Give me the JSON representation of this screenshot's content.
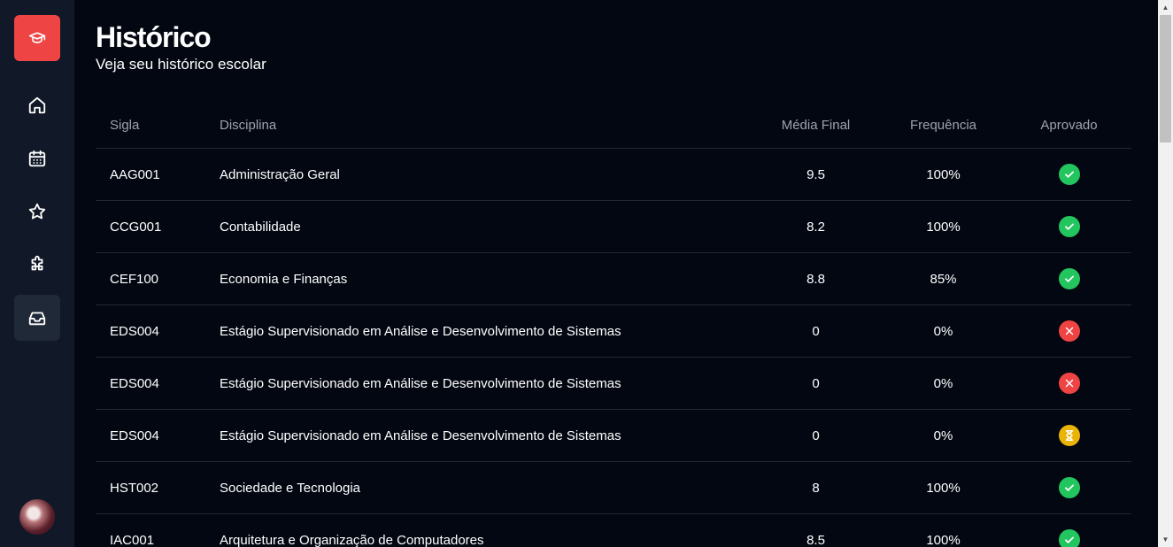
{
  "sidebar": {
    "logo_icon": "graduation-cap-icon",
    "brand_color": "#ef4444",
    "items": [
      {
        "name": "home",
        "icon": "home-icon"
      },
      {
        "name": "calendar",
        "icon": "calendar-icon"
      },
      {
        "name": "favorites",
        "icon": "star-icon"
      },
      {
        "name": "extensions",
        "icon": "puzzle-icon"
      },
      {
        "name": "history",
        "icon": "inbox-icon",
        "active": true
      }
    ]
  },
  "header": {
    "title": "Histórico",
    "subtitle": "Veja seu histórico escolar"
  },
  "table": {
    "columns": {
      "sigla": "Sigla",
      "disciplina": "Disciplina",
      "media": "Média Final",
      "frequencia": "Frequência",
      "aprovado": "Aprovado"
    },
    "rows": [
      {
        "sigla": "AAG001",
        "disciplina": "Administração Geral",
        "media": "9.5",
        "frequencia": "100%",
        "status": "approved"
      },
      {
        "sigla": "CCG001",
        "disciplina": "Contabilidade",
        "media": "8.2",
        "frequencia": "100%",
        "status": "approved"
      },
      {
        "sigla": "CEF100",
        "disciplina": "Economia e Finanças",
        "media": "8.8",
        "frequencia": "85%",
        "status": "approved"
      },
      {
        "sigla": "EDS004",
        "disciplina": "Estágio Supervisionado em Análise e Desenvolvimento de Sistemas",
        "media": "0",
        "frequencia": "0%",
        "status": "failed"
      },
      {
        "sigla": "EDS004",
        "disciplina": "Estágio Supervisionado em Análise e Desenvolvimento de Sistemas",
        "media": "0",
        "frequencia": "0%",
        "status": "failed"
      },
      {
        "sigla": "EDS004",
        "disciplina": "Estágio Supervisionado em Análise e Desenvolvimento de Sistemas",
        "media": "0",
        "frequencia": "0%",
        "status": "pending"
      },
      {
        "sigla": "HST002",
        "disciplina": "Sociedade e Tecnologia",
        "media": "8",
        "frequencia": "100%",
        "status": "approved"
      },
      {
        "sigla": "IAC001",
        "disciplina": "Arquitetura e Organização de Computadores",
        "media": "8.5",
        "frequencia": "100%",
        "status": "approved"
      }
    ]
  },
  "status_colors": {
    "approved": "#22c55e",
    "failed": "#ef4444",
    "pending": "#eab308"
  }
}
